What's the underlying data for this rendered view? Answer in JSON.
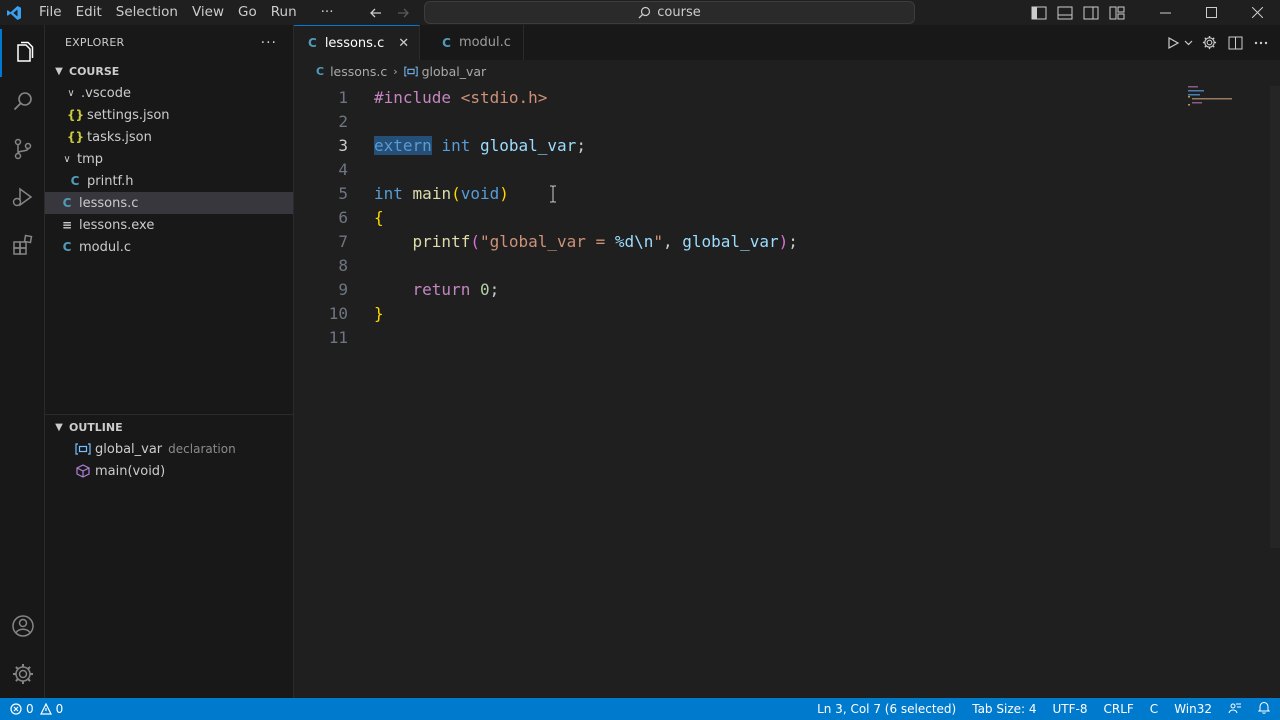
{
  "menu": [
    "File",
    "Edit",
    "Selection",
    "View",
    "Go",
    "Run"
  ],
  "menu_more": "···",
  "search": {
    "text": "course"
  },
  "explorer": {
    "title": "EXPLORER",
    "more": "···",
    "folder": "COURSE",
    "items": [
      {
        "label": ".vscode",
        "type": "folder"
      },
      {
        "label": "settings.json",
        "type": "json",
        "icon": "{}"
      },
      {
        "label": "tasks.json",
        "type": "json",
        "icon": "{}"
      },
      {
        "label": "tmp",
        "type": "folder"
      },
      {
        "label": "printf.h",
        "type": "c",
        "icon": "C"
      },
      {
        "label": "lessons.c",
        "type": "c",
        "icon": "C"
      },
      {
        "label": "lessons.exe",
        "type": "exe",
        "icon": "≡"
      },
      {
        "label": "modul.c",
        "type": "c",
        "icon": "C"
      }
    ]
  },
  "outline": {
    "title": "OUTLINE",
    "items": [
      {
        "label": "global_var",
        "detail": "declaration"
      },
      {
        "label": "main(void)"
      }
    ]
  },
  "tabs": [
    {
      "label": "lessons.c",
      "icon": "C",
      "active": true,
      "close": "✕"
    },
    {
      "label": "modul.c",
      "icon": "C",
      "active": false
    }
  ],
  "breadcrumb": {
    "file": "lessons.c",
    "icon": "C",
    "symbol": "global_var",
    "sep": "›"
  },
  "code": {
    "line_numbers": [
      "1",
      "2",
      "3",
      "4",
      "5",
      "6",
      "7",
      "8",
      "9",
      "10",
      "11"
    ],
    "l1_pp": "#include",
    "l1_hdr": " <stdio.h>",
    "l3_extern": "extern",
    "l3_int": "int",
    "l3_var": "global_var",
    "l3_semi": ";",
    "l5_int": "int",
    "l5_main": "main",
    "l5_lp": "(",
    "l5_void": "void",
    "l5_rp": ")",
    "l6": "{",
    "l7_fn": "printf",
    "l7_lp": "(",
    "l7_str1": "\"global_var = ",
    "l7_fmt": "%d\\n",
    "l7_str2": "\"",
    "l7_comma": ", ",
    "l7_var": "global_var",
    "l7_rp": ")",
    "l7_semi": ";",
    "l9_ret": "return",
    "l9_num": "0",
    "l9_semi": ";",
    "l10": "}"
  },
  "status": {
    "errors": "0",
    "warnings": "0",
    "position": "Ln 3, Col 7 (6 selected)",
    "tab_size": "Tab Size: 4",
    "encoding": "UTF-8",
    "eol": "CRLF",
    "language": "C",
    "platform": "Win32"
  },
  "colors": {
    "accent": "#007acc",
    "background": "#1f1f1f",
    "sidebar": "#181818",
    "selection": "#264f78"
  }
}
